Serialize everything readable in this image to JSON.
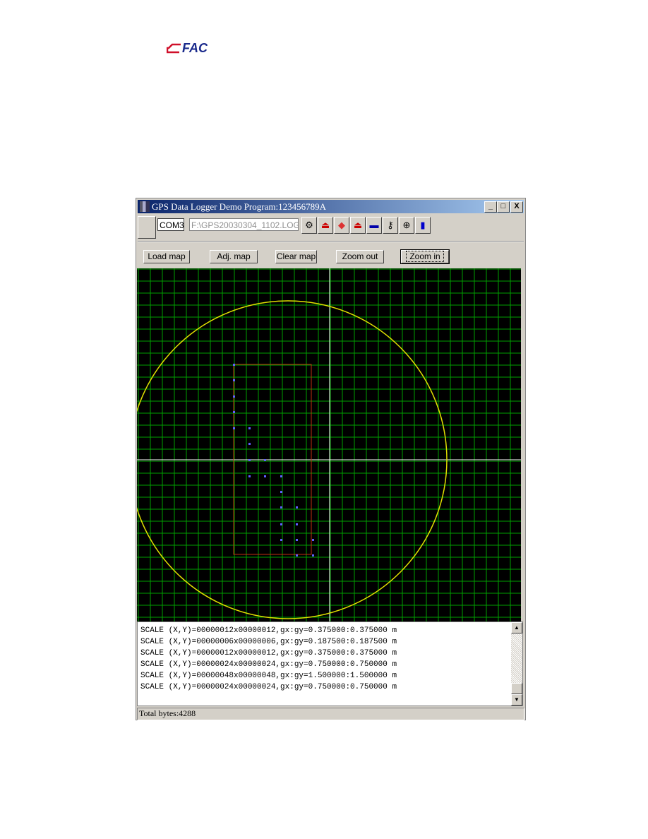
{
  "logo": {
    "text": "FAC",
    "color": "#1a2a8c",
    "accent": "#d0102a"
  },
  "window": {
    "title": "GPS Data Logger Demo Program:123456789A",
    "minimize": "_",
    "maximize": "□",
    "close": "X"
  },
  "toolbar": {
    "port": "COM3",
    "file": "F:\\GPS20030304_1102.LOG",
    "icons": [
      "connect-icon",
      "upload-icon",
      "erase-icon",
      "download-icon",
      "ship-icon",
      "key-icon",
      "target-icon",
      "exit-door-icon"
    ]
  },
  "buttons": {
    "load_map": "Load map",
    "adj_map": "Adj. map",
    "clear_map": "Clear map",
    "zoom_out": "Zoom out",
    "zoom_in": "Zoom in"
  },
  "map": {
    "grid_color": "#00a000",
    "circle_color": "#e0e000",
    "rect_color": "#c03010",
    "point_color": "#6060ff",
    "crosshair_color": "#ffffff"
  },
  "log": [
    "SCALE (X,Y)=00000012x00000012,gx:gy=0.375000:0.375000 m",
    "SCALE (X,Y)=00000006x00000006,gx:gy=0.187500:0.187500 m",
    "SCALE (X,Y)=00000012x00000012,gx:gy=0.375000:0.375000 m",
    "SCALE (X,Y)=00000024x00000024,gx:gy=0.750000:0.750000 m",
    "SCALE (X,Y)=00000048x00000048,gx:gy=1.500000:1.500000 m",
    "SCALE (X,Y)=00000024x00000024,gx:gy=0.750000:0.750000 m"
  ],
  "status": "Total bytes:4288"
}
